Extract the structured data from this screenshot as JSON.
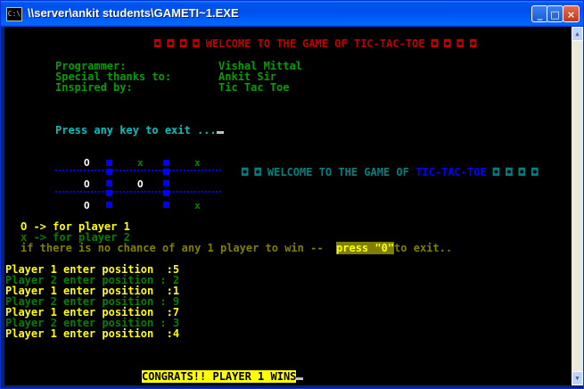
{
  "window": {
    "title": "\\\\server\\ankit students\\GAMETI~1.EXE",
    "icon": "console-icon",
    "buttons": [
      "_",
      "□",
      "×"
    ]
  },
  "console": {
    "banner1": "◘ ◘ ◘ ◘ WELCOME TO THE GAME OF TIC-TAC-TOE ◘ ◘ ◘ ◘",
    "credits": [
      {
        "label": "Programmer:",
        "value": "Vishal Mittal"
      },
      {
        "label": "Special thanks to:",
        "value": "Ankit Sir"
      },
      {
        "label": "Inspired by:",
        "value": "Tic Tac Toe"
      }
    ],
    "press_key": "Press any key to exit ...",
    "banner2_left": "◘ ◘ WELCOME TO THE GAME OF ",
    "banner2_game": "TIC-TAC-TOE",
    "banner2_right": " ◘ ◘ ◘ ◘",
    "board": [
      [
        "O",
        "",
        "x",
        "",
        "x"
      ],
      [
        "O",
        "",
        "O",
        "",
        ""
      ],
      [
        "O",
        "",
        "",
        "",
        "x"
      ]
    ],
    "legend": {
      "p1": "O -> for player 1",
      "p2": "x -> for player 2",
      "draw_pre": "if there is no chance of any 1 player to win --  ",
      "draw_key": "press \"0\"",
      "draw_post": "to exit.."
    },
    "moves": [
      {
        "player": 1,
        "text": "Player 1 enter position  :5"
      },
      {
        "player": 2,
        "text": "Player 2 enter position : 2"
      },
      {
        "player": 1,
        "text": "Player 1 enter position  :1"
      },
      {
        "player": 2,
        "text": "Player 2 enter position : 9"
      },
      {
        "player": 1,
        "text": "Player 1 enter position  :7"
      },
      {
        "player": 2,
        "text": "Player 2 enter position : 3"
      },
      {
        "player": 1,
        "text": "Player 1 enter position  :4"
      }
    ],
    "result": "CONGRATS!! PLAYER 1 WINS"
  }
}
